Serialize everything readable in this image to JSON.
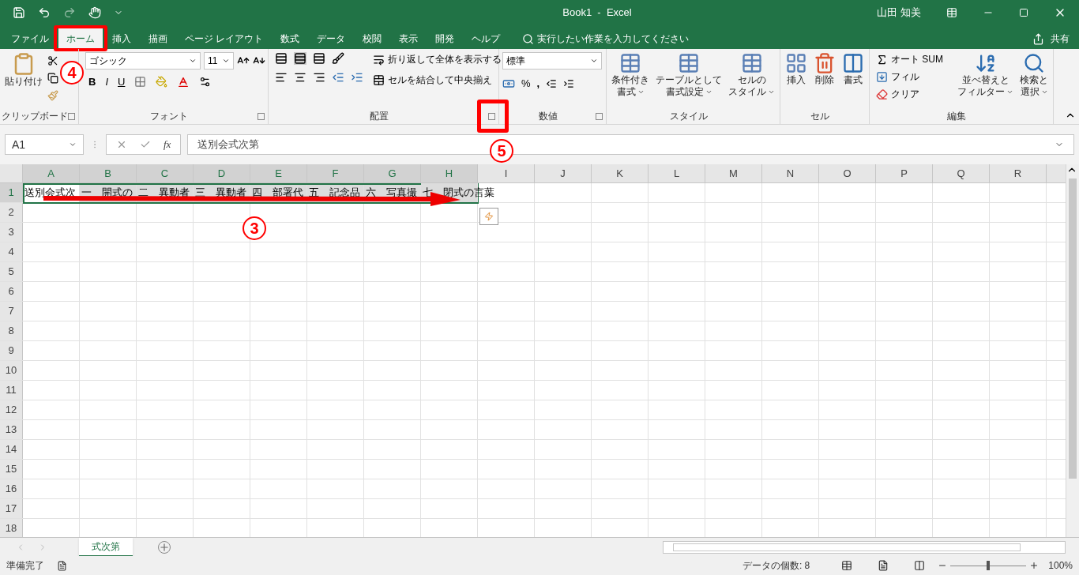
{
  "title_bar": {
    "title": "Book1  -  Excel",
    "user": "山田 知美"
  },
  "menu_tabs": [
    {
      "label": "ファイル",
      "selected": false,
      "highlighted": false
    },
    {
      "label": "ホーム",
      "selected": true,
      "highlighted": true
    },
    {
      "label": "挿入",
      "selected": false,
      "highlighted": false
    },
    {
      "label": "描画",
      "selected": false,
      "highlighted": false
    },
    {
      "label": "ページ レイアウト",
      "selected": false,
      "highlighted": false
    },
    {
      "label": "数式",
      "selected": false,
      "highlighted": false
    },
    {
      "label": "データ",
      "selected": false,
      "highlighted": false
    },
    {
      "label": "校閲",
      "selected": false,
      "highlighted": false
    },
    {
      "label": "表示",
      "selected": false,
      "highlighted": false
    },
    {
      "label": "開発",
      "selected": false,
      "highlighted": false
    },
    {
      "label": "ヘルプ",
      "selected": false,
      "highlighted": false
    }
  ],
  "tell_me": {
    "placeholder": "実行したい作業を入力してください"
  },
  "share": "共有",
  "ribbon": {
    "clipboard": {
      "paste": "貼り付け",
      "label": "クリップボード"
    },
    "font": {
      "name": "ゴシック",
      "size": "11",
      "bold": "B",
      "italic": "I",
      "underline": "U",
      "label": "フォント"
    },
    "alignment": {
      "wrap": "折り返して全体を表示する",
      "merge": "セルを結合して中央揃え",
      "label": "配置",
      "launcher_highlighted": true
    },
    "number": {
      "format": "標準",
      "percent": "%",
      "comma": ",",
      "label": "数値"
    },
    "styles": {
      "buttons": [
        [
          "条件付き",
          "書式"
        ],
        [
          "テーブルとして",
          "書式設定"
        ],
        [
          "セルの",
          "スタイル"
        ]
      ],
      "label": "スタイル"
    },
    "cells": {
      "buttons": [
        "挿入",
        "削除",
        "書式"
      ],
      "label": "セル"
    },
    "editing": {
      "autosum": "オート SUM",
      "fill": "フィル",
      "clear": "クリア",
      "sort": [
        "並べ替えと",
        "フィルター"
      ],
      "find": [
        "検索と",
        "選択"
      ],
      "label": "編集"
    }
  },
  "formula_bar": {
    "name_box": "A1",
    "fx": "fx",
    "value": "送別会式次第"
  },
  "columns": [
    {
      "label": "A",
      "selected": true
    },
    {
      "label": "B",
      "selected": true
    },
    {
      "label": "C",
      "selected": true
    },
    {
      "label": "D",
      "selected": true
    },
    {
      "label": "E",
      "selected": true
    },
    {
      "label": "F",
      "selected": true
    },
    {
      "label": "G",
      "selected": true
    },
    {
      "label": "H",
      "selected": true
    },
    {
      "label": "I",
      "selected": false
    },
    {
      "label": "J",
      "selected": false
    },
    {
      "label": "K",
      "selected": false
    },
    {
      "label": "L",
      "selected": false
    },
    {
      "label": "M",
      "selected": false
    },
    {
      "label": "N",
      "selected": false
    },
    {
      "label": "O",
      "selected": false
    },
    {
      "label": "P",
      "selected": false
    },
    {
      "label": "Q",
      "selected": false
    },
    {
      "label": "R",
      "selected": false
    }
  ],
  "rows": [
    "1",
    "2",
    "3",
    "4",
    "5",
    "6",
    "7",
    "8",
    "9",
    "10",
    "11",
    "12",
    "13",
    "14",
    "15",
    "16",
    "17",
    "18"
  ],
  "row1_cells": [
    "送別会式次",
    "一　開式の",
    "二　異動者",
    "三　異動者",
    "四　部署代",
    "五　記念品",
    "六　写真撮",
    "七　閉式の言葉"
  ],
  "sheet_tabs": [
    {
      "label": "式次第",
      "selected": true
    }
  ],
  "status_bar": {
    "ready": "準備完了",
    "count": "データの個数: 8",
    "zoom": "100%",
    "zoom_slider": {
      "level": 0.5
    }
  },
  "annotations": [
    {
      "label": "4"
    },
    {
      "label": "5"
    },
    {
      "label": "3"
    }
  ]
}
